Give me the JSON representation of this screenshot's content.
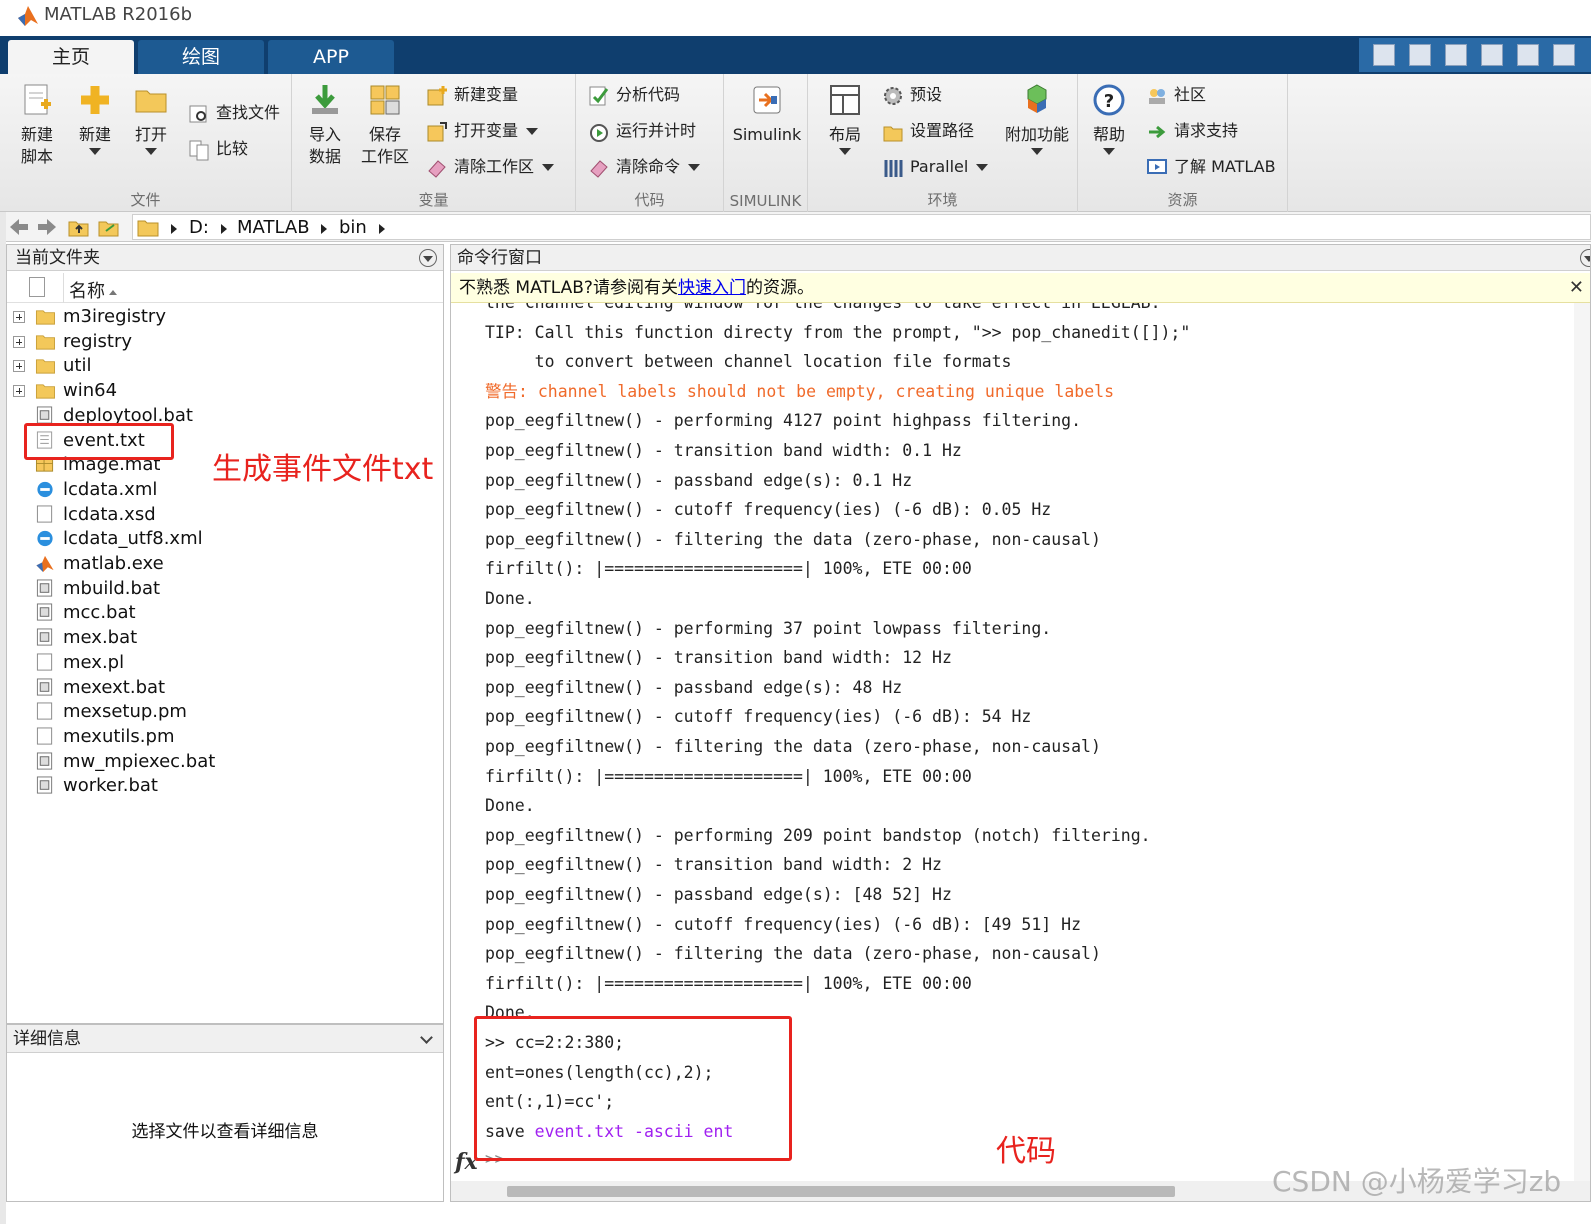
{
  "app": {
    "title": "MATLAB R2016b"
  },
  "tabs": [
    "主页",
    "绘图",
    "APP"
  ],
  "ribbon": {
    "file": {
      "label": "文件",
      "new_script": "新建\n脚本",
      "new": "新建",
      "open": "打开",
      "find_files": "查找文件",
      "compare": "比较"
    },
    "variable": {
      "label": "变量",
      "import": "导入\n数据",
      "save": "保存\n工作区",
      "new_var": "新建变量",
      "open_var": "打开变量",
      "clear_ws": "清除工作区"
    },
    "code": {
      "label": "代码",
      "analyze": "分析代码",
      "run_time": "运行并计时",
      "clear_cmd": "清除命令"
    },
    "simulink": {
      "label": "SIMULINK",
      "simulink": "Simulink"
    },
    "env": {
      "label": "环境",
      "layout": "布局",
      "prefs": "预设",
      "set_path": "设置路径",
      "parallel": "Parallel",
      "addons": "附加功能"
    },
    "resources": {
      "label": "资源",
      "help": "帮助",
      "community": "社区",
      "support": "请求支持",
      "learn": "了解 MATLAB"
    }
  },
  "address": {
    "path": [
      "D:",
      "MATLAB",
      "bin"
    ]
  },
  "current_folder": {
    "title": "当前文件夹",
    "column": "名称",
    "items": [
      {
        "name": "m3iregistry",
        "type": "folder"
      },
      {
        "name": "registry",
        "type": "folder"
      },
      {
        "name": "util",
        "type": "folder"
      },
      {
        "name": "win64",
        "type": "folder"
      },
      {
        "name": "deploytool.bat",
        "type": "bat"
      },
      {
        "name": "event.txt",
        "type": "txt"
      },
      {
        "name": "image.mat",
        "type": "mat"
      },
      {
        "name": "lcdata.xml",
        "type": "xml"
      },
      {
        "name": "lcdata.xsd",
        "type": "doc"
      },
      {
        "name": "lcdata_utf8.xml",
        "type": "xml"
      },
      {
        "name": "matlab.exe",
        "type": "exe"
      },
      {
        "name": "mbuild.bat",
        "type": "bat"
      },
      {
        "name": "mcc.bat",
        "type": "bat"
      },
      {
        "name": "mex.bat",
        "type": "bat"
      },
      {
        "name": "mex.pl",
        "type": "doc"
      },
      {
        "name": "mexext.bat",
        "type": "bat"
      },
      {
        "name": "mexsetup.pm",
        "type": "doc"
      },
      {
        "name": "mexutils.pm",
        "type": "doc"
      },
      {
        "name": "mw_mpiexec.bat",
        "type": "bat"
      },
      {
        "name": "worker.bat",
        "type": "bat"
      }
    ]
  },
  "details": {
    "title": "详细信息",
    "placeholder": "选择文件以查看详细信息"
  },
  "command_window": {
    "title": "命令行窗口",
    "banner_pre": "不熟悉 MATLAB?请参阅有关",
    "banner_link": "快速入门",
    "banner_post": "的资源。",
    "lines": [
      {
        "text": "the channel editing window for the changes to take effect in EEGLAB.",
        "style": ""
      },
      {
        "text": "TIP: Call this function directy from the prompt, \">> pop_chanedit([]);\"",
        "style": ""
      },
      {
        "text": "     to convert between channel location file formats",
        "style": ""
      },
      {
        "text": "警告: channel labels should not be empty, creating unique labels",
        "style": "warn"
      },
      {
        "text": "pop_eegfiltnew() - performing 4127 point highpass filtering.",
        "style": ""
      },
      {
        "text": "pop_eegfiltnew() - transition band width: 0.1 Hz",
        "style": ""
      },
      {
        "text": "pop_eegfiltnew() - passband edge(s): 0.1 Hz",
        "style": ""
      },
      {
        "text": "pop_eegfiltnew() - cutoff frequency(ies) (-6 dB): 0.05 Hz",
        "style": ""
      },
      {
        "text": "pop_eegfiltnew() - filtering the data (zero-phase, non-causal)",
        "style": ""
      },
      {
        "text": "firfilt(): |====================| 100%, ETE 00:00",
        "style": ""
      },
      {
        "text": "Done.",
        "style": ""
      },
      {
        "text": "pop_eegfiltnew() - performing 37 point lowpass filtering.",
        "style": ""
      },
      {
        "text": "pop_eegfiltnew() - transition band width: 12 Hz",
        "style": ""
      },
      {
        "text": "pop_eegfiltnew() - passband edge(s): 48 Hz",
        "style": ""
      },
      {
        "text": "pop_eegfiltnew() - cutoff frequency(ies) (-6 dB): 54 Hz",
        "style": ""
      },
      {
        "text": "pop_eegfiltnew() - filtering the data (zero-phase, non-causal)",
        "style": ""
      },
      {
        "text": "firfilt(): |====================| 100%, ETE 00:00",
        "style": ""
      },
      {
        "text": "Done.",
        "style": ""
      },
      {
        "text": "pop_eegfiltnew() - performing 209 point bandstop (notch) filtering.",
        "style": ""
      },
      {
        "text": "pop_eegfiltnew() - transition band width: 2 Hz",
        "style": ""
      },
      {
        "text": "pop_eegfiltnew() - passband edge(s): [48 52] Hz",
        "style": ""
      },
      {
        "text": "pop_eegfiltnew() - cutoff frequency(ies) (-6 dB): [49 51] Hz",
        "style": ""
      },
      {
        "text": "pop_eegfiltnew() - filtering the data (zero-phase, non-causal)",
        "style": ""
      },
      {
        "text": "firfilt(): |====================| 100%, ETE 00:00",
        "style": ""
      },
      {
        "text": "Done.",
        "style": ""
      },
      {
        "text": ">> cc=2:2:380;",
        "style": ""
      },
      {
        "text": "ent=ones(length(cc),2);",
        "style": ""
      },
      {
        "text": "ent(:,1)=cc';",
        "style": ""
      }
    ],
    "save_cmd": "save ",
    "save_args": "event.txt -ascii ent",
    "fx": "fx",
    "prompt": ">>"
  },
  "annotations": {
    "file_note": "生成事件文件txt",
    "code_note": "代码",
    "color": "#e8231e"
  },
  "watermark": "CSDN @小杨爱学习zb"
}
